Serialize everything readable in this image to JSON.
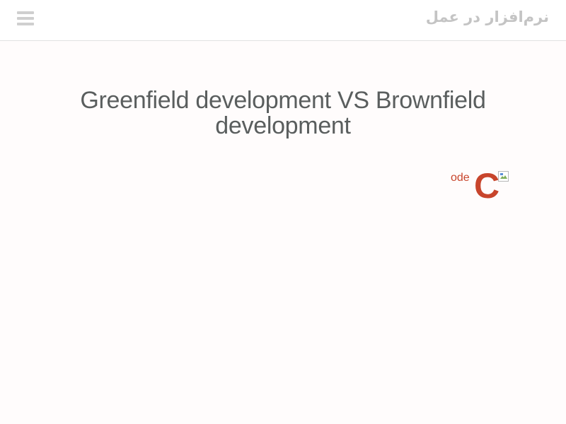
{
  "header": {
    "site_title": "نرم‌افزار در عمل",
    "menu_icon": "hamburger-menu-icon"
  },
  "main": {
    "title": "Greenfield development VS Brownfield development",
    "logo": {
      "small_text": "ode",
      "big_letter": "C",
      "color": "#c8452c",
      "broken_image_icon": "broken-image-icon"
    }
  },
  "colors": {
    "background": "#fffcfc",
    "header_background": "#ffffff",
    "title_text": "#5a5e5e",
    "header_text": "#c4c4c4",
    "accent": "#c8452c"
  }
}
